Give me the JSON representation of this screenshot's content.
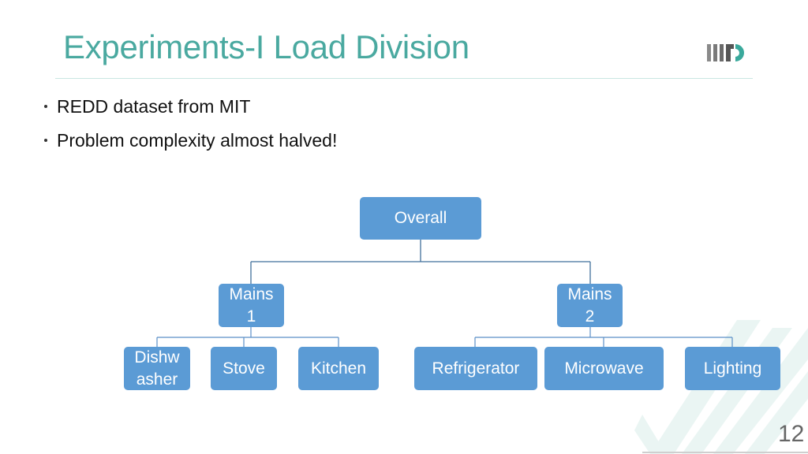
{
  "slide": {
    "title": "Experiments-I Load Division",
    "page_number": "12",
    "logo_icon": "iiitd-logo-icon",
    "accent_color": "#4aa9a0",
    "node_color": "#5b9bd5",
    "connector_color": "#41719c"
  },
  "bullets": [
    {
      "text": "REDD dataset from MIT"
    },
    {
      "text": "Problem complexity almost halved!"
    }
  ],
  "tree": {
    "root": {
      "label": "Overall"
    },
    "mains": [
      {
        "label": "Mains\n1",
        "line1": "Mains",
        "line2": "1",
        "children": [
          {
            "label": "Dishwasher",
            "line1": "Dishw",
            "line2": "asher"
          },
          {
            "label": "Stove"
          },
          {
            "label": "Kitchen"
          }
        ]
      },
      {
        "label": "Mains\n2",
        "line1": "Mains",
        "line2": "2",
        "children": [
          {
            "label": "Refrigerator"
          },
          {
            "label": "Microwave"
          },
          {
            "label": "Lighting"
          }
        ]
      }
    ]
  }
}
